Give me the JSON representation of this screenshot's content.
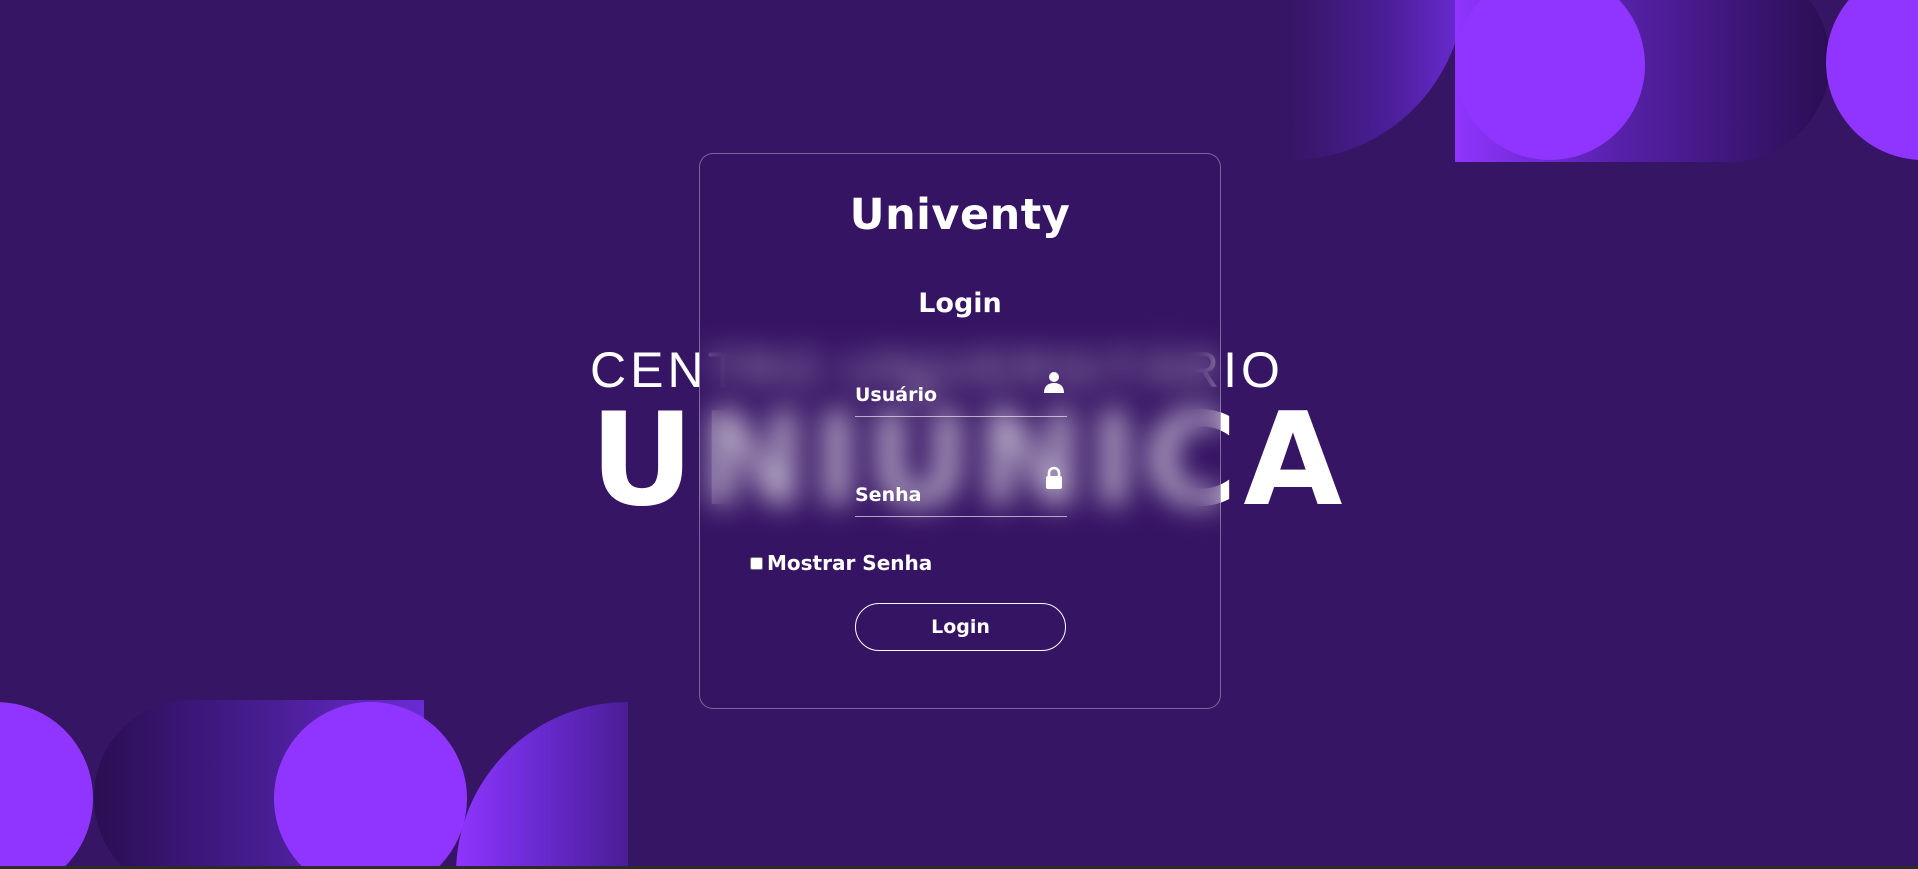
{
  "background": {
    "brand_line1": "CENTRO UNIVERSITÁRIO",
    "brand_line2": "UNIÚNICA"
  },
  "login": {
    "brand": "Univenty",
    "title": "Login",
    "username_placeholder": "Usuário",
    "password_placeholder": "Senha",
    "show_password_label": "Mostrar Senha",
    "submit_label": "Login"
  },
  "icons": {
    "username": "user-icon",
    "password": "lock-icon"
  },
  "colors": {
    "background": "#371565",
    "accent": "#8f35ff",
    "text": "#ffffff"
  }
}
